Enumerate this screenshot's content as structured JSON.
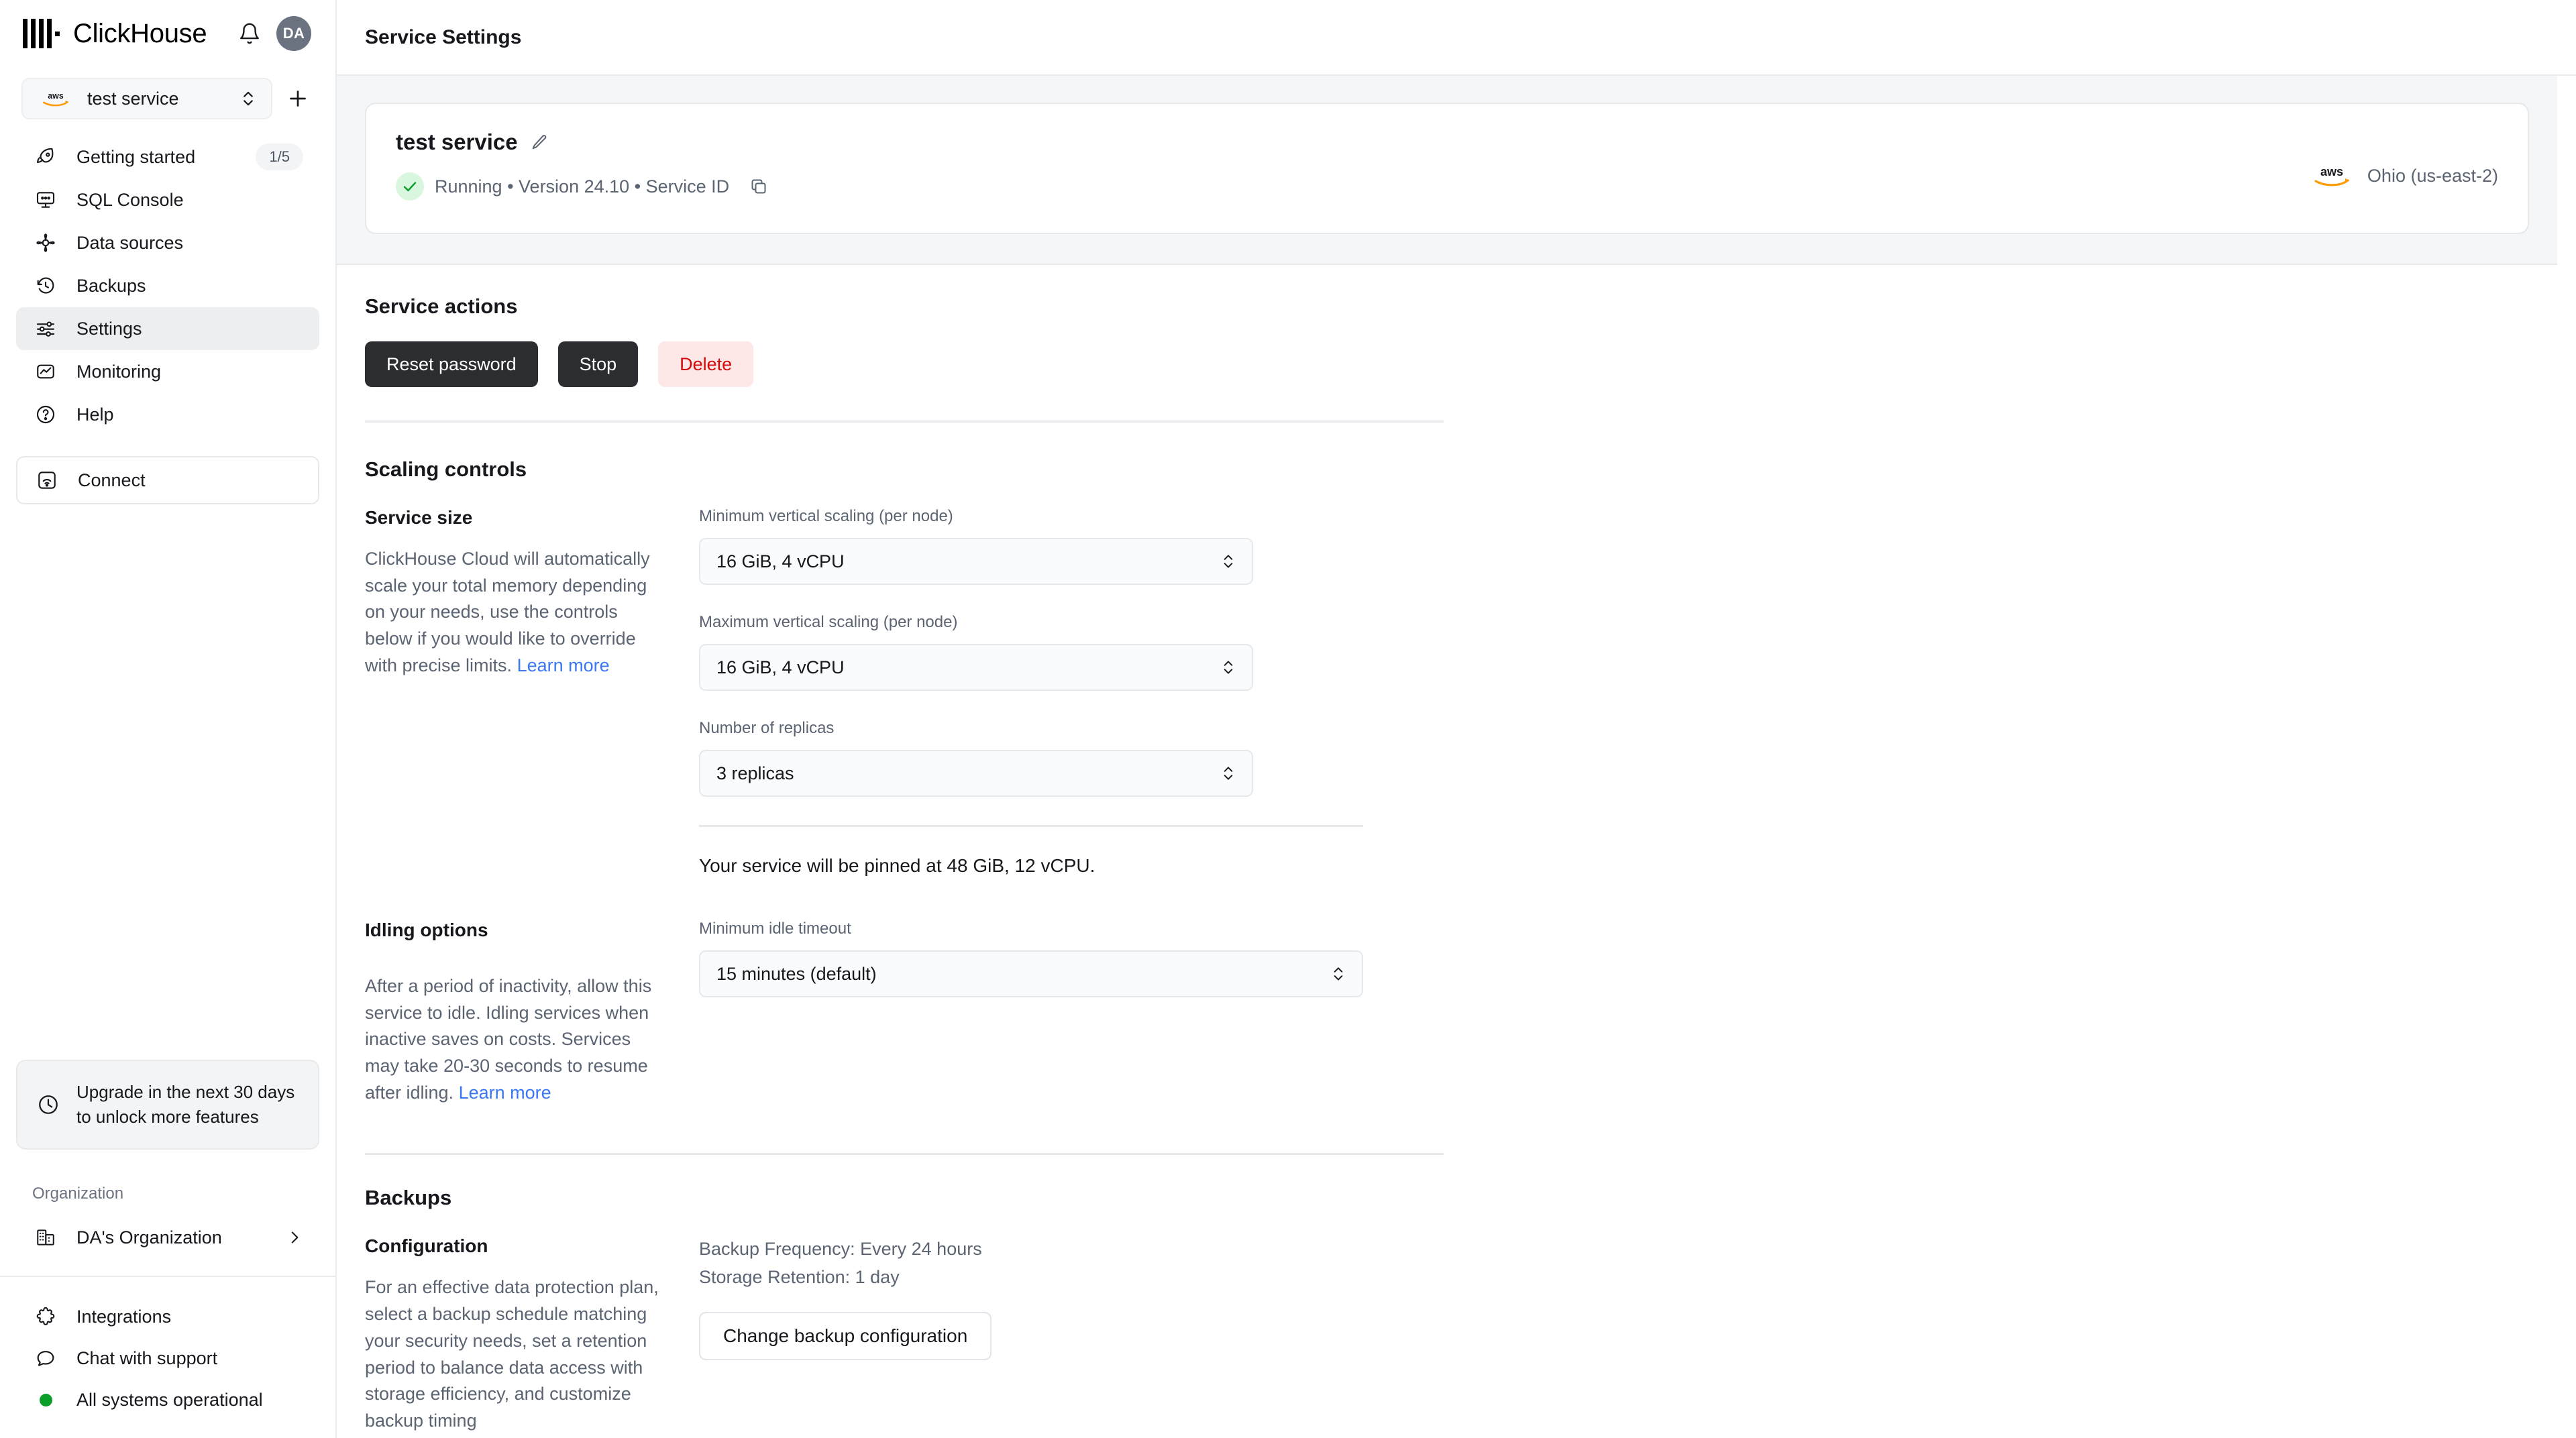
{
  "sidebar": {
    "brand": "ClickHouse",
    "avatar_initials": "DA",
    "service_selector": {
      "label": "test service",
      "cloud_icon": "aws-icon"
    },
    "add_service_label": "+",
    "nav_items": [
      {
        "label": "Getting started",
        "icon": "rocket-icon",
        "badge": "1/5",
        "active": false
      },
      {
        "label": "SQL Console",
        "icon": "console-icon",
        "badge": "",
        "active": false
      },
      {
        "label": "Data sources",
        "icon": "data-sources-icon",
        "badge": "",
        "active": false
      },
      {
        "label": "Backups",
        "icon": "history-icon",
        "badge": "",
        "active": false
      },
      {
        "label": "Settings",
        "icon": "sliders-icon",
        "badge": "",
        "active": true
      },
      {
        "label": "Monitoring",
        "icon": "chart-box-icon",
        "badge": "",
        "active": false
      },
      {
        "label": "Help",
        "icon": "question-circle-icon",
        "badge": "",
        "active": false
      }
    ],
    "connect": {
      "label": "Connect",
      "icon": "signal-icon"
    },
    "upgrade_banner": {
      "text": "Upgrade in the next 30 days to unlock more features",
      "icon": "clock-icon"
    },
    "organization": {
      "section_label": "Organization",
      "name": "DA's Organization",
      "icon": "building-icon",
      "chevron": "chevron-right-icon"
    },
    "bottom_items": [
      {
        "label": "Integrations",
        "icon": "puzzle-icon"
      },
      {
        "label": "Chat with support",
        "icon": "chat-bubble-icon"
      },
      {
        "label": "All systems operational",
        "icon": "status-dot-icon"
      }
    ],
    "status_color": "#0a9e29"
  },
  "topbar": {
    "title": "Service Settings"
  },
  "service_card": {
    "name": "test service",
    "edit_icon": "pencil-icon",
    "status": "Running",
    "status_icon": "check-icon",
    "meta": "Running • Version 24.10 • Service ID",
    "copy_icon": "copy-icon",
    "cloud_icon": "aws-icon",
    "region": "Ohio (us-east-2)"
  },
  "service_actions": {
    "title": "Service actions",
    "reset_password_label": "Reset password",
    "stop_label": "Stop",
    "delete_label": "Delete",
    "delete_color": "#d40b0b"
  },
  "scaling": {
    "title": "Scaling controls",
    "service_size": {
      "heading": "Service size",
      "description": "ClickHouse Cloud will automatically scale your total memory depending on your needs, use the controls below if you would like to override with precise limits.",
      "learn_more": "Learn more"
    },
    "fields": [
      {
        "label": "Minimum vertical scaling (per node)",
        "value": "16 GiB, 4 vCPU"
      },
      {
        "label": "Maximum vertical scaling (per node)",
        "value": "16 GiB, 4 vCPU"
      },
      {
        "label": "Number of replicas",
        "value": "3 replicas"
      }
    ],
    "pinned_note": "Your service will be pinned at 48 GiB, 12 vCPU.",
    "idling": {
      "heading": "Idling options",
      "description": "After a period of inactivity, allow this service to idle. Idling services when inactive saves on costs. Services may take 20-30 seconds to resume after idling.",
      "learn_more": "Learn more",
      "field_label": "Minimum idle timeout",
      "field_value": "15 minutes (default)"
    }
  },
  "backups": {
    "title": "Backups",
    "configuration": {
      "heading": "Configuration",
      "description": "For an effective data protection plan, select a backup schedule matching your security needs, set a retention period to balance data access with storage efficiency, and customize backup timing"
    },
    "frequency": "Backup Frequency: Every 24 hours",
    "retention": "Storage Retention: 1 day",
    "change_button": "Change backup configuration"
  }
}
